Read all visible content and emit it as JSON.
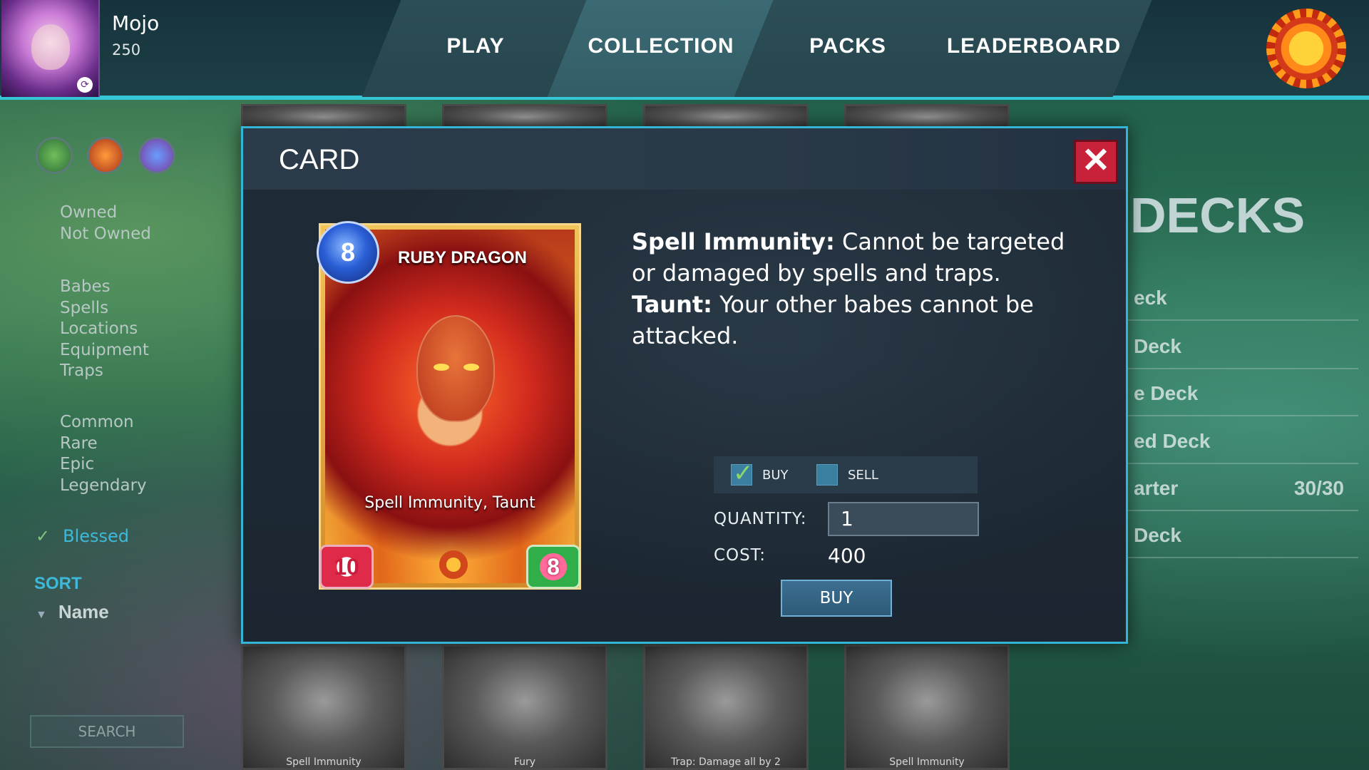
{
  "player": {
    "name": "Mojo",
    "score": "250"
  },
  "nav": {
    "tabs": [
      {
        "label": "PLAY"
      },
      {
        "label": "COLLECTION"
      },
      {
        "label": "PACKS"
      },
      {
        "label": "LEADERBOARD"
      }
    ],
    "active": "COLLECTION"
  },
  "sidebar": {
    "ownership": [
      "Owned",
      "Not Owned"
    ],
    "types": [
      "Babes",
      "Spells",
      "Locations",
      "Equipment",
      "Traps"
    ],
    "rarity": [
      "Common",
      "Rare",
      "Epic",
      "Legendary"
    ],
    "blessed": "Blessed",
    "sort_header": "SORT",
    "sort_by": "Name",
    "search_placeholder": "SEARCH"
  },
  "background_cards": {
    "bottom_captions": [
      "Spell Immunity",
      "Fury",
      "Trap: Damage all by 2",
      "Spell Immunity"
    ]
  },
  "decks": {
    "title": "DECKS",
    "rows": [
      {
        "name": "eck",
        "count": ""
      },
      {
        "name": "Deck",
        "count": ""
      },
      {
        "name": "e Deck",
        "count": ""
      },
      {
        "name": "ed Deck",
        "count": ""
      },
      {
        "name": "arter",
        "count": "30/30"
      },
      {
        "name": "Deck",
        "count": ""
      }
    ]
  },
  "modal": {
    "title": "CARD",
    "close_label": "✕",
    "card": {
      "name": "RUBY DRAGON",
      "cost": "8",
      "keywords": "Spell Immunity, Taunt",
      "attack": "10",
      "health": "8"
    },
    "abilities": [
      {
        "keyword": "Spell Immunity:",
        "text": " Cannot be targeted or damaged by spells and traps."
      },
      {
        "keyword": "Taunt:",
        "text": " Your other babes cannot be attacked."
      }
    ],
    "trade": {
      "buy_label": "BUY",
      "sell_label": "SELL",
      "mode": "BUY",
      "quantity_label": "QUANTITY:",
      "quantity": "1",
      "cost_label": "COST:",
      "cost": "400",
      "buy_button": "BUY"
    }
  },
  "colors": {
    "accent": "#35c6d6",
    "close": "#c8213a",
    "highlight": "#3fb9d9"
  }
}
